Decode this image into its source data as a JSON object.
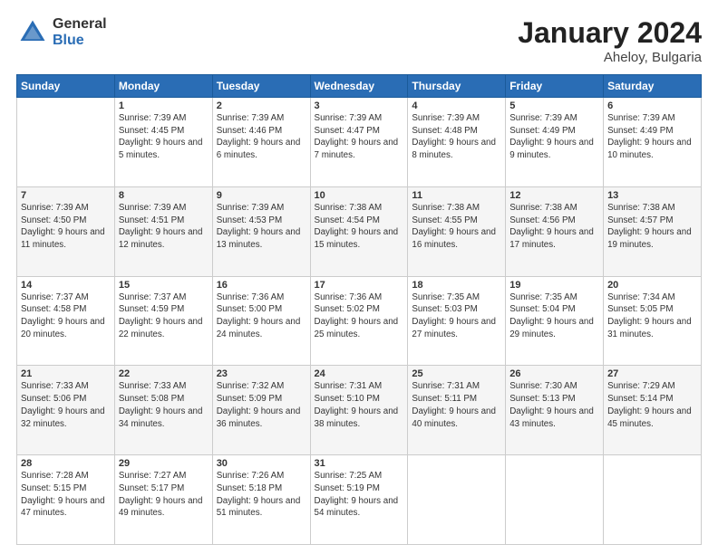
{
  "header": {
    "logo_general": "General",
    "logo_blue": "Blue",
    "title": "January 2024",
    "location": "Aheloy, Bulgaria"
  },
  "weekdays": [
    "Sunday",
    "Monday",
    "Tuesday",
    "Wednesday",
    "Thursday",
    "Friday",
    "Saturday"
  ],
  "weeks": [
    [
      {
        "day": "",
        "sunrise": "",
        "sunset": "",
        "daylight": ""
      },
      {
        "day": "1",
        "sunrise": "Sunrise: 7:39 AM",
        "sunset": "Sunset: 4:45 PM",
        "daylight": "Daylight: 9 hours and 5 minutes."
      },
      {
        "day": "2",
        "sunrise": "Sunrise: 7:39 AM",
        "sunset": "Sunset: 4:46 PM",
        "daylight": "Daylight: 9 hours and 6 minutes."
      },
      {
        "day": "3",
        "sunrise": "Sunrise: 7:39 AM",
        "sunset": "Sunset: 4:47 PM",
        "daylight": "Daylight: 9 hours and 7 minutes."
      },
      {
        "day": "4",
        "sunrise": "Sunrise: 7:39 AM",
        "sunset": "Sunset: 4:48 PM",
        "daylight": "Daylight: 9 hours and 8 minutes."
      },
      {
        "day": "5",
        "sunrise": "Sunrise: 7:39 AM",
        "sunset": "Sunset: 4:49 PM",
        "daylight": "Daylight: 9 hours and 9 minutes."
      },
      {
        "day": "6",
        "sunrise": "Sunrise: 7:39 AM",
        "sunset": "Sunset: 4:49 PM",
        "daylight": "Daylight: 9 hours and 10 minutes."
      }
    ],
    [
      {
        "day": "7",
        "sunrise": "Sunrise: 7:39 AM",
        "sunset": "Sunset: 4:50 PM",
        "daylight": "Daylight: 9 hours and 11 minutes."
      },
      {
        "day": "8",
        "sunrise": "Sunrise: 7:39 AM",
        "sunset": "Sunset: 4:51 PM",
        "daylight": "Daylight: 9 hours and 12 minutes."
      },
      {
        "day": "9",
        "sunrise": "Sunrise: 7:39 AM",
        "sunset": "Sunset: 4:53 PM",
        "daylight": "Daylight: 9 hours and 13 minutes."
      },
      {
        "day": "10",
        "sunrise": "Sunrise: 7:38 AM",
        "sunset": "Sunset: 4:54 PM",
        "daylight": "Daylight: 9 hours and 15 minutes."
      },
      {
        "day": "11",
        "sunrise": "Sunrise: 7:38 AM",
        "sunset": "Sunset: 4:55 PM",
        "daylight": "Daylight: 9 hours and 16 minutes."
      },
      {
        "day": "12",
        "sunrise": "Sunrise: 7:38 AM",
        "sunset": "Sunset: 4:56 PM",
        "daylight": "Daylight: 9 hours and 17 minutes."
      },
      {
        "day": "13",
        "sunrise": "Sunrise: 7:38 AM",
        "sunset": "Sunset: 4:57 PM",
        "daylight": "Daylight: 9 hours and 19 minutes."
      }
    ],
    [
      {
        "day": "14",
        "sunrise": "Sunrise: 7:37 AM",
        "sunset": "Sunset: 4:58 PM",
        "daylight": "Daylight: 9 hours and 20 minutes."
      },
      {
        "day": "15",
        "sunrise": "Sunrise: 7:37 AM",
        "sunset": "Sunset: 4:59 PM",
        "daylight": "Daylight: 9 hours and 22 minutes."
      },
      {
        "day": "16",
        "sunrise": "Sunrise: 7:36 AM",
        "sunset": "Sunset: 5:00 PM",
        "daylight": "Daylight: 9 hours and 24 minutes."
      },
      {
        "day": "17",
        "sunrise": "Sunrise: 7:36 AM",
        "sunset": "Sunset: 5:02 PM",
        "daylight": "Daylight: 9 hours and 25 minutes."
      },
      {
        "day": "18",
        "sunrise": "Sunrise: 7:35 AM",
        "sunset": "Sunset: 5:03 PM",
        "daylight": "Daylight: 9 hours and 27 minutes."
      },
      {
        "day": "19",
        "sunrise": "Sunrise: 7:35 AM",
        "sunset": "Sunset: 5:04 PM",
        "daylight": "Daylight: 9 hours and 29 minutes."
      },
      {
        "day": "20",
        "sunrise": "Sunrise: 7:34 AM",
        "sunset": "Sunset: 5:05 PM",
        "daylight": "Daylight: 9 hours and 31 minutes."
      }
    ],
    [
      {
        "day": "21",
        "sunrise": "Sunrise: 7:33 AM",
        "sunset": "Sunset: 5:06 PM",
        "daylight": "Daylight: 9 hours and 32 minutes."
      },
      {
        "day": "22",
        "sunrise": "Sunrise: 7:33 AM",
        "sunset": "Sunset: 5:08 PM",
        "daylight": "Daylight: 9 hours and 34 minutes."
      },
      {
        "day": "23",
        "sunrise": "Sunrise: 7:32 AM",
        "sunset": "Sunset: 5:09 PM",
        "daylight": "Daylight: 9 hours and 36 minutes."
      },
      {
        "day": "24",
        "sunrise": "Sunrise: 7:31 AM",
        "sunset": "Sunset: 5:10 PM",
        "daylight": "Daylight: 9 hours and 38 minutes."
      },
      {
        "day": "25",
        "sunrise": "Sunrise: 7:31 AM",
        "sunset": "Sunset: 5:11 PM",
        "daylight": "Daylight: 9 hours and 40 minutes."
      },
      {
        "day": "26",
        "sunrise": "Sunrise: 7:30 AM",
        "sunset": "Sunset: 5:13 PM",
        "daylight": "Daylight: 9 hours and 43 minutes."
      },
      {
        "day": "27",
        "sunrise": "Sunrise: 7:29 AM",
        "sunset": "Sunset: 5:14 PM",
        "daylight": "Daylight: 9 hours and 45 minutes."
      }
    ],
    [
      {
        "day": "28",
        "sunrise": "Sunrise: 7:28 AM",
        "sunset": "Sunset: 5:15 PM",
        "daylight": "Daylight: 9 hours and 47 minutes."
      },
      {
        "day": "29",
        "sunrise": "Sunrise: 7:27 AM",
        "sunset": "Sunset: 5:17 PM",
        "daylight": "Daylight: 9 hours and 49 minutes."
      },
      {
        "day": "30",
        "sunrise": "Sunrise: 7:26 AM",
        "sunset": "Sunset: 5:18 PM",
        "daylight": "Daylight: 9 hours and 51 minutes."
      },
      {
        "day": "31",
        "sunrise": "Sunrise: 7:25 AM",
        "sunset": "Sunset: 5:19 PM",
        "daylight": "Daylight: 9 hours and 54 minutes."
      },
      {
        "day": "",
        "sunrise": "",
        "sunset": "",
        "daylight": ""
      },
      {
        "day": "",
        "sunrise": "",
        "sunset": "",
        "daylight": ""
      },
      {
        "day": "",
        "sunrise": "",
        "sunset": "",
        "daylight": ""
      }
    ]
  ]
}
